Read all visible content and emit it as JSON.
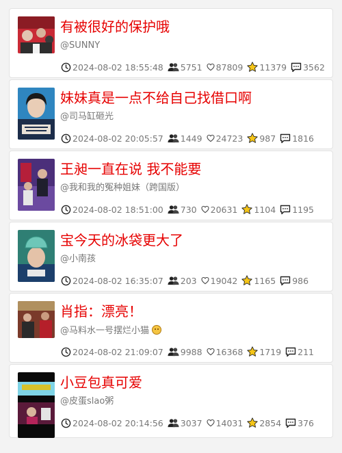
{
  "posts": [
    {
      "title": "有被很好的保护哦",
      "author": "@SUNNY",
      "time": "2024-08-02 18:55:48",
      "views": "5751",
      "likes": "87809",
      "stars": "11379",
      "comments": "3562",
      "thumb_colors": [
        "#b7212b",
        "#3a3a3a",
        "#d9d0c8"
      ]
    },
    {
      "title": "妹妹真是一点不给自己找借口啊",
      "author": "@司马缸砸光",
      "time": "2024-08-02 20:05:57",
      "views": "1449",
      "likes": "24723",
      "stars": "987",
      "comments": "1816",
      "thumb_colors": [
        "#2b7fb8",
        "#1a2a45",
        "#e8e1d7"
      ]
    },
    {
      "title": "王昶一直在说 我不能要",
      "author": "@我和我的冤种姐妹（跨国版）",
      "time": "2024-08-02 18:51:00",
      "views": "730",
      "likes": "20631",
      "stars": "1104",
      "comments": "1195",
      "thumb_colors": [
        "#5c3a8f",
        "#b51f3a",
        "#1f1f2e"
      ]
    },
    {
      "title": "宝今天的冰袋更大了",
      "author": "@小南孩",
      "time": "2024-08-02 16:35:07",
      "views": "203",
      "likes": "19042",
      "stars": "1165",
      "comments": "986",
      "thumb_colors": [
        "#3a9a8a",
        "#1c3f6b",
        "#d9b8a0"
      ]
    },
    {
      "title": "肖指：漂亮！",
      "author": "@马料水一号摆烂小猫",
      "time": "2024-08-02 21:09:07",
      "views": "9988",
      "likes": "16368",
      "stars": "1719",
      "comments": "211",
      "thumb_colors": [
        "#8b3a2a",
        "#2a2a2a",
        "#b0905f"
      ]
    },
    {
      "title": "小豆包真可爱",
      "author": "@皮蛋slao粥",
      "time": "2024-08-02 20:14:56",
      "views": "3037",
      "likes": "14031",
      "stars": "2854",
      "comments": "376",
      "thumb_colors": [
        "#0a0a0a",
        "#d7c22a",
        "#b5245a"
      ]
    }
  ],
  "colors": {
    "title": "#e60000",
    "muted": "#777777",
    "star": "#f5c518"
  },
  "icons": {
    "time": "clock-icon",
    "views": "people-icon",
    "likes": "heart-icon",
    "stars": "star-icon",
    "comments": "comment-icon",
    "author_emoji_post_5": "cat-face-icon"
  }
}
